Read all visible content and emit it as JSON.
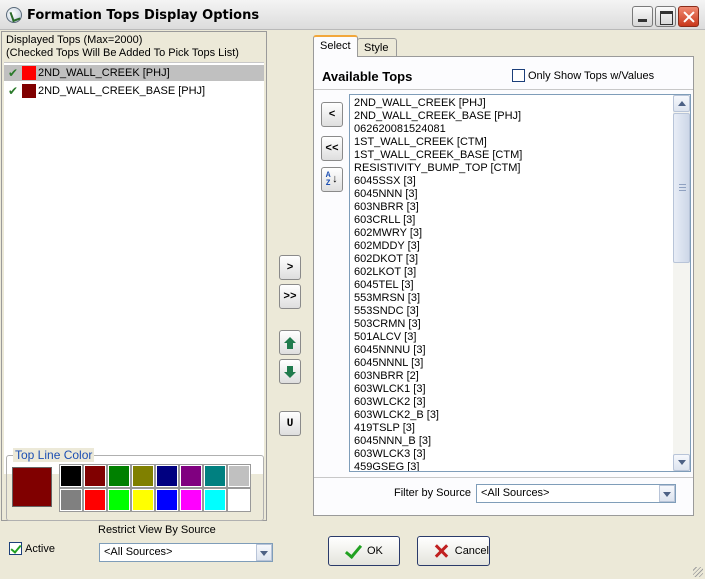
{
  "window": {
    "title": "Formation Tops Display Options",
    "icon": "app-globe-check-icon"
  },
  "left": {
    "header_line1": "Displayed Tops (Max=2000)",
    "header_line2": "(Checked Tops Will Be Added To Pick Tops List)",
    "displayed_tops": [
      {
        "label": "2ND_WALL_CREEK [PHJ]",
        "color": "#ff0000",
        "checked": true,
        "selected": true
      },
      {
        "label": "2ND_WALL_CREEK_BASE [PHJ]",
        "color": "#800000",
        "checked": true,
        "selected": false
      }
    ],
    "top_line_color": {
      "label": "Top Line Color",
      "current": "#800000",
      "palette": [
        "#000000",
        "#800000",
        "#008000",
        "#808000",
        "#000080",
        "#800080",
        "#008080",
        "#c0c0c0",
        "#808080",
        "#ff0000",
        "#00ff00",
        "#ffff00",
        "#0000ff",
        "#ff00ff",
        "#00ffff",
        "#ffffff"
      ]
    },
    "restrict_label": "Restrict View By Source",
    "active_label": "Active",
    "active_checked": true,
    "restrict_value": "<All Sources>"
  },
  "middle": {
    "add_label": ">",
    "add_all_label": ">>",
    "move_up_icon": "arrow-up-icon",
    "move_down_icon": "arrow-down-icon",
    "u_label": "U"
  },
  "right": {
    "tabs": [
      {
        "label": "Select",
        "active": true
      },
      {
        "label": "Style",
        "active": false
      }
    ],
    "available_title": "Available Tops",
    "only_show_label": "Only Show Tops w/Values",
    "only_show_checked": false,
    "remove_label": "<",
    "remove_all_label": "<<",
    "sort_icon": "sort-az-icon",
    "sort_letters": [
      "A",
      "Z"
    ],
    "available_tops": [
      "2ND_WALL_CREEK [PHJ]",
      "2ND_WALL_CREEK_BASE [PHJ]",
      "062620081524081",
      "1ST_WALL_CREEK [CTM]",
      "1ST_WALL_CREEK_BASE [CTM]",
      "RESISTIVITY_BUMP_TOP [CTM]",
      "6045SSX [3]",
      "6045NNN [3]",
      "603NBRR [3]",
      "603CRLL [3]",
      "602MWRY [3]",
      "602MDDY [3]",
      "602DKOT [3]",
      "602LKOT [3]",
      "6045TEL [3]",
      "553MRSN [3]",
      "553SNDC [3]",
      "503CRMN [3]",
      "501ALCV [3]",
      "6045NNNU [3]",
      "6045NNNL [3]",
      "603NBRR [2]",
      "603WLCK1 [3]",
      "603WLCK2 [3]",
      "603WLCK2_B [3]",
      "419TSLP [3]",
      "6045NNN_B [3]",
      "603WLCK3 [3]",
      "459GSEG [3]"
    ],
    "filter_label": "Filter by Source",
    "filter_value": "<All Sources>"
  },
  "buttons": {
    "ok": "OK",
    "cancel": "Cancel"
  }
}
